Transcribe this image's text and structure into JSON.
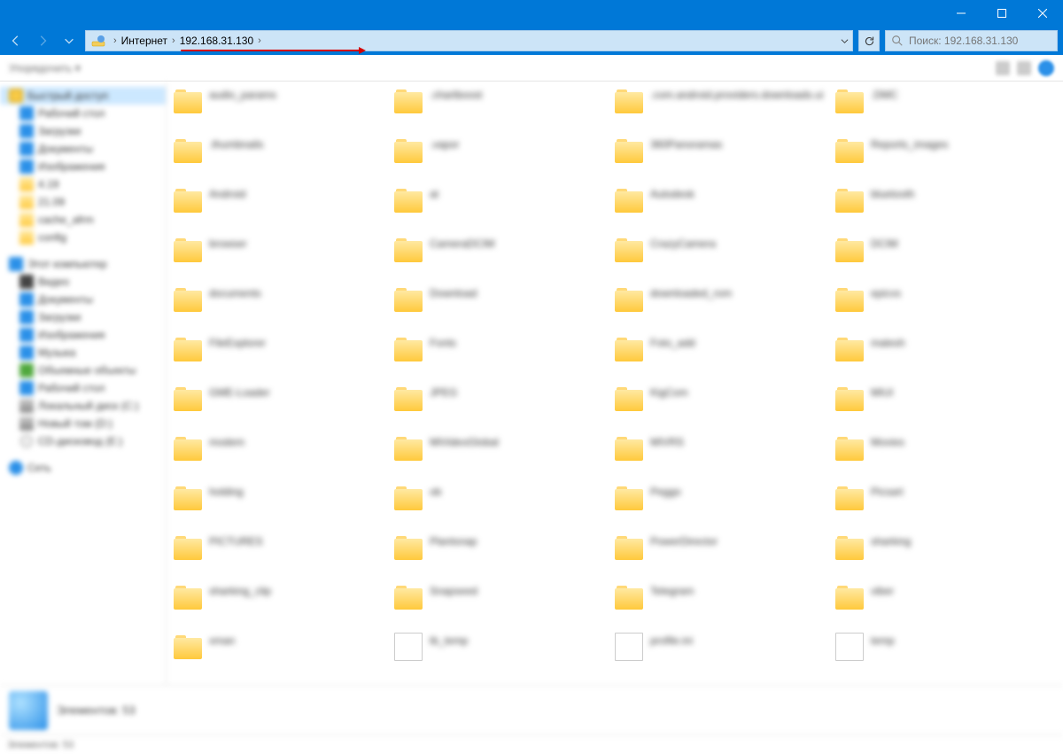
{
  "titlebar": {},
  "nav": {
    "breadcrumb": {
      "root": "Интернет",
      "path": "192.168.31.130"
    },
    "search_placeholder": "Поиск: 192.168.31.130"
  },
  "commandbar": {
    "organize_label": "Упорядочить ▾"
  },
  "sidebar": {
    "groups": [
      {
        "header": "Быстрый доступ",
        "header_icon": "star",
        "selected": true,
        "items": [
          {
            "label": "Рабочий стол",
            "icon": "blue"
          },
          {
            "label": "Загрузки",
            "icon": "blue"
          },
          {
            "label": "Документы",
            "icon": "blue"
          },
          {
            "label": "Изображения",
            "icon": "blue"
          },
          {
            "label": "4.19",
            "icon": "folder"
          },
          {
            "label": "21.09",
            "icon": "folder"
          },
          {
            "label": "cache_afrm",
            "icon": "folder"
          },
          {
            "label": "config",
            "icon": "folder"
          }
        ]
      },
      {
        "header": "Этот компьютер",
        "header_icon": "blue",
        "items": [
          {
            "label": "Видео",
            "icon": "dark"
          },
          {
            "label": "Документы",
            "icon": "blue"
          },
          {
            "label": "Загрузки",
            "icon": "blue"
          },
          {
            "label": "Изображения",
            "icon": "blue"
          },
          {
            "label": "Музыка",
            "icon": "blue"
          },
          {
            "label": "Объемные объекты",
            "icon": "green"
          },
          {
            "label": "Рабочий стол",
            "icon": "blue"
          },
          {
            "label": "Локальный диск (C:)",
            "icon": "drive"
          },
          {
            "label": "Новый том (D:)",
            "icon": "drive"
          },
          {
            "label": "CD-дисковод (E:)",
            "icon": "cd"
          }
        ]
      },
      {
        "header": "Сеть",
        "header_icon": "net",
        "items": []
      }
    ]
  },
  "folders": {
    "items": [
      {
        "name": "audio_params",
        "type": "folder"
      },
      {
        "name": ".chartboost",
        "type": "folder"
      },
      {
        "name": ".com.android.providers.downloads.ui",
        "type": "folder"
      },
      {
        "name": ".DMC",
        "type": "folder"
      },
      {
        "name": ".thumbnails",
        "type": "folder"
      },
      {
        "name": ".vapor",
        "type": "folder"
      },
      {
        "name": "360Panoramas",
        "type": "folder"
      },
      {
        "name": "Reports_images",
        "type": "folder"
      },
      {
        "name": "Android",
        "type": "folder"
      },
      {
        "name": "at",
        "type": "folder"
      },
      {
        "name": "Autodesk",
        "type": "folder"
      },
      {
        "name": "bluetooth",
        "type": "folder"
      },
      {
        "name": "browser",
        "type": "folder"
      },
      {
        "name": "CameraDCIM",
        "type": "folder"
      },
      {
        "name": "CrazyCamera",
        "type": "folder"
      },
      {
        "name": "DCIM",
        "type": "folder"
      },
      {
        "name": "documents",
        "type": "folder"
      },
      {
        "name": "Download",
        "type": "folder"
      },
      {
        "name": "downloaded_rom",
        "type": "folder"
      },
      {
        "name": "epicvs",
        "type": "folder"
      },
      {
        "name": "FileExplorer",
        "type": "folder"
      },
      {
        "name": "Fonts",
        "type": "folder"
      },
      {
        "name": "Foto_add",
        "type": "folder"
      },
      {
        "name": "malesh",
        "type": "folder"
      },
      {
        "name": "GME-Loader",
        "type": "folder"
      },
      {
        "name": "JPEG",
        "type": "folder"
      },
      {
        "name": "KigCom",
        "type": "folder"
      },
      {
        "name": "MIUI",
        "type": "folder"
      },
      {
        "name": "modem",
        "type": "folder"
      },
      {
        "name": "MiVideoGlobal",
        "type": "folder"
      },
      {
        "name": "MIVRS",
        "type": "folder"
      },
      {
        "name": "Movies",
        "type": "folder"
      },
      {
        "name": "holding",
        "type": "folder"
      },
      {
        "name": "ob",
        "type": "folder"
      },
      {
        "name": "Peggo",
        "type": "folder"
      },
      {
        "name": "Picsart",
        "type": "folder"
      },
      {
        "name": "PICTURES",
        "type": "folder"
      },
      {
        "name": "Plantsnap",
        "type": "folder"
      },
      {
        "name": "PowerDirector",
        "type": "folder"
      },
      {
        "name": "sharking",
        "type": "folder"
      },
      {
        "name": "sharking_clip",
        "type": "folder"
      },
      {
        "name": "Snapseed",
        "type": "folder"
      },
      {
        "name": "Telegram",
        "type": "folder"
      },
      {
        "name": "viber",
        "type": "folder"
      },
      {
        "name": "xman",
        "type": "folder"
      },
      {
        "name": "tb_temp",
        "type": "file"
      },
      {
        "name": "profile.ini",
        "type": "file"
      },
      {
        "name": "temp",
        "type": "file"
      }
    ]
  },
  "details": {
    "title": "Элементов: 53"
  },
  "statusbar": {
    "text": "Элементов: 53"
  }
}
